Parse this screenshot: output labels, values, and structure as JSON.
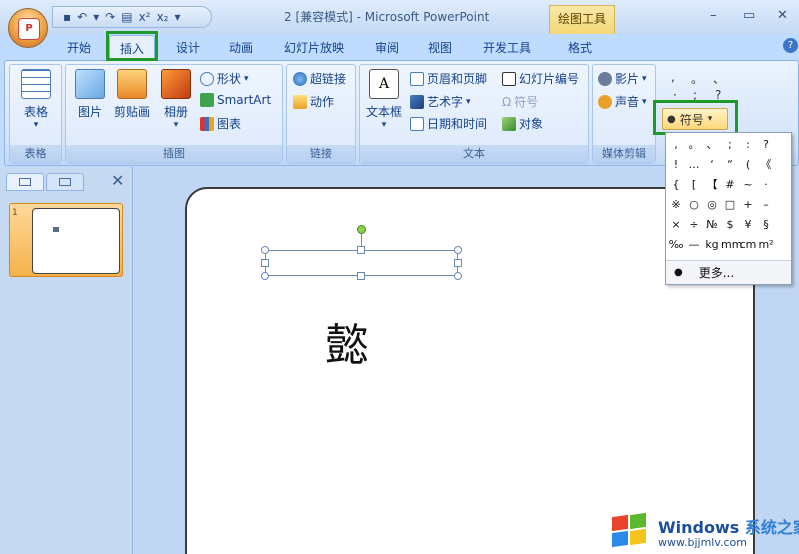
{
  "window": {
    "title": "2 [兼容模式] - Microsoft PowerPoint",
    "context_tab_header": "绘图工具",
    "controls": [
      "–",
      "▭",
      "✕"
    ]
  },
  "qat": {
    "save_icon": "save-icon",
    "undo_icon": "undo-icon",
    "redo_icon": "redo-icon",
    "items": [
      "▾",
      "x²",
      "x₂",
      "▾"
    ]
  },
  "tabs": [
    "开始",
    "插入",
    "设计",
    "动画",
    "幻灯片放映",
    "审阅",
    "视图",
    "开发工具",
    "格式"
  ],
  "active_tab": "插入",
  "ribbon": {
    "groups": {
      "table": {
        "label": "表格",
        "button": "表格"
      },
      "illustrations": {
        "label": "插图",
        "picture": "图片",
        "clipart": "剪贴画",
        "album": "相册",
        "shapes": "形状",
        "smartart": "SmartArt",
        "chart": "图表"
      },
      "links": {
        "label": "链接",
        "hyperlink": "超链接",
        "action": "动作"
      },
      "text": {
        "label": "文本",
        "textbox": "文本框",
        "header_footer": "页眉和页脚",
        "wordart": "艺术字",
        "datetime": "日期和时间",
        "slide_number": "幻灯片编号",
        "symbol": "符号",
        "object": "对象"
      },
      "media": {
        "label": "媒体剪辑",
        "movie": "影片",
        "sound": "声音"
      }
    },
    "symbol_strip": [
      ",",
      "。",
      "、",
      "·",
      ";",
      "?"
    ],
    "symbol_button": "符号"
  },
  "symbol_panel": {
    "symbols": [
      ",",
      "。",
      "、",
      ";",
      ":",
      "?",
      "",
      "!",
      "…",
      "‘",
      "“",
      "(",
      "《",
      "",
      "{",
      "[",
      "【",
      "#",
      "~",
      "·",
      "",
      "※",
      "○",
      "◎",
      "□",
      "+",
      "–",
      "",
      "×",
      "÷",
      "№",
      "$",
      "¥",
      "§",
      "",
      "‰",
      "—",
      "kg",
      "mm",
      "cm",
      "m²",
      ""
    ],
    "more": "更多..."
  },
  "slide_panel": {
    "slide_number": "1"
  },
  "slide": {
    "character": "懿"
  },
  "watermark": {
    "title_en": "Windows",
    "title_cn": "系统之家",
    "url": "www.bjjmlv.com"
  }
}
